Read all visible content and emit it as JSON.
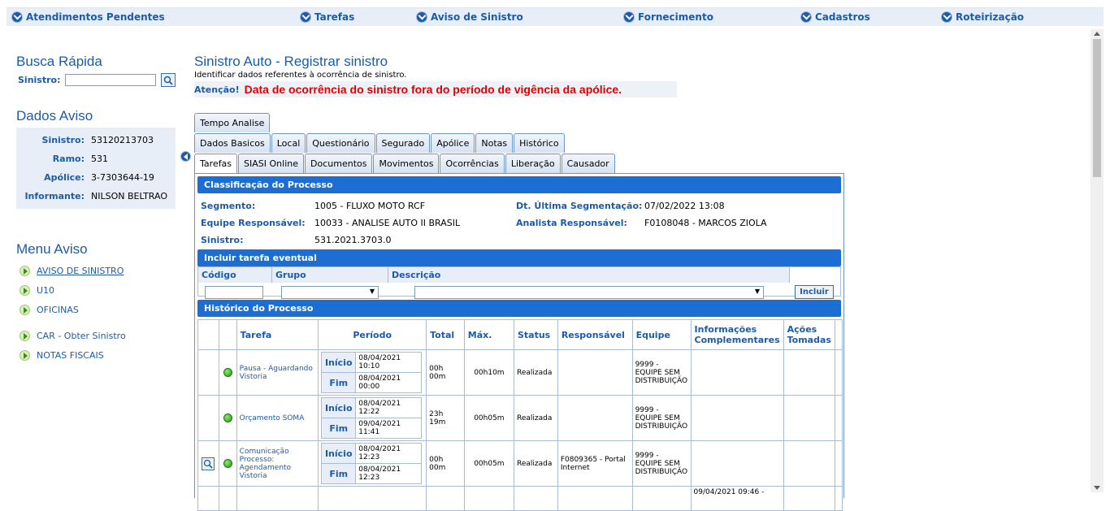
{
  "topnav": [
    {
      "label": "Atendimentos Pendentes"
    },
    {
      "label": "Tarefas"
    },
    {
      "label": "Aviso de Sinistro"
    },
    {
      "label": "Fornecimento"
    },
    {
      "label": "Cadastros"
    },
    {
      "label": "Roteirização"
    }
  ],
  "busca": {
    "title": "Busca Rápida",
    "label": "Sinistro:",
    "value": ""
  },
  "dados": {
    "title": "Dados Aviso",
    "rows": [
      {
        "k": "Sinistro:",
        "v": "53120213703"
      },
      {
        "k": "Ramo:",
        "v": "531"
      },
      {
        "k": "Apólice:",
        "v": "3-7303644-19"
      },
      {
        "k": "Informante:",
        "v": "NILSON BELTRAO"
      }
    ]
  },
  "menu": {
    "title": "Menu Aviso",
    "items": [
      "AVISO DE SINISTRO",
      "U10",
      "OFICINAS",
      "CAR - Obter Sinistro",
      "NOTAS FISCAIS"
    ]
  },
  "page": {
    "title": "Sinistro Auto - Registrar sinistro",
    "subtitle": "Identificar dados referentes à ocorrência de sinistro.",
    "warn_label": "Atenção!",
    "warn_text": "Data de ocorrência do sinistro fora do período de vigência da apólice."
  },
  "tabs": {
    "row1": [
      "Tempo Analise"
    ],
    "row2": [
      "Dados Basicos",
      "Local",
      "Questionário",
      "Segurado",
      "Apólice",
      "Notas",
      "Histórico"
    ],
    "row3": [
      "Tarefas",
      "SIASI Online",
      "Documentos",
      "Movimentos",
      "Ocorrências",
      "Liberação",
      "Causador"
    ]
  },
  "classif": {
    "title": "Classificação do Processo",
    "segmento_k": "Segmento:",
    "segmento_v": "1005 - FLUXO MOTO RCF",
    "equipe_k": "Equipe Responsável:",
    "equipe_v": "10033 - ANALISE AUTO II BRASIL",
    "sinistro_k": "Sinistro:",
    "sinistro_v": "531.2021.3703.0",
    "dtseg_k": "Dt. Última Segmentação:",
    "dtseg_v": "07/02/2022 13:08",
    "analista_k": "Analista Responsável:",
    "analista_v": "F0108048 - MARCOS ZIOLA"
  },
  "incluir": {
    "title": "Incluir tarefa eventual",
    "h_codigo": "Código",
    "h_grupo": "Grupo",
    "h_descricao": "Descrição",
    "button": "Incluir"
  },
  "historico": {
    "title": "Histórico do Processo",
    "headers": [
      "Tarefa",
      "Período",
      "Total",
      "Máx.",
      "Status",
      "Responsável",
      "Equipe",
      "Informações Complementares",
      "Ações Tomadas"
    ],
    "label_inicio": "Início",
    "label_fim": "Fim",
    "rows": [
      {
        "tarefa": "Pausa - Aguardando Vistoria",
        "inicio": "08/04/2021 10:10",
        "fim": "08/04/2021 00:00",
        "total": "00h 00m",
        "max": "00h10m",
        "status": "Realizada",
        "resp": "",
        "equipe": "9999 - EQUIPE SEM DISTRIBUIÇÃO",
        "info": ""
      },
      {
        "tarefa": "Orçamento SOMA",
        "inicio": "08/04/2021 12:22",
        "fim": "09/04/2021 11:41",
        "total": "23h 19m",
        "max": "00h05m",
        "status": "Realizada",
        "resp": "",
        "equipe": "9999 - EQUIPE SEM DISTRIBUIÇÃO",
        "info": ""
      },
      {
        "tarefa": "Comunicação Processo: Agendamento Vistoria",
        "inicio": "08/04/2021 12:23",
        "fim": "08/04/2021 12:23",
        "total": "00h 00m",
        "max": "00h05m",
        "status": "Realizada",
        "resp": "F0809365 - Portal Internet",
        "equipe": "9999 - EQUIPE SEM DISTRIBUIÇÃO",
        "info": ""
      },
      {
        "tarefa": "",
        "inicio": "",
        "fim": "",
        "total": "",
        "max": "",
        "status": "",
        "resp": "",
        "equipe": "",
        "info": "09/04/2021 09:46 -"
      }
    ]
  }
}
